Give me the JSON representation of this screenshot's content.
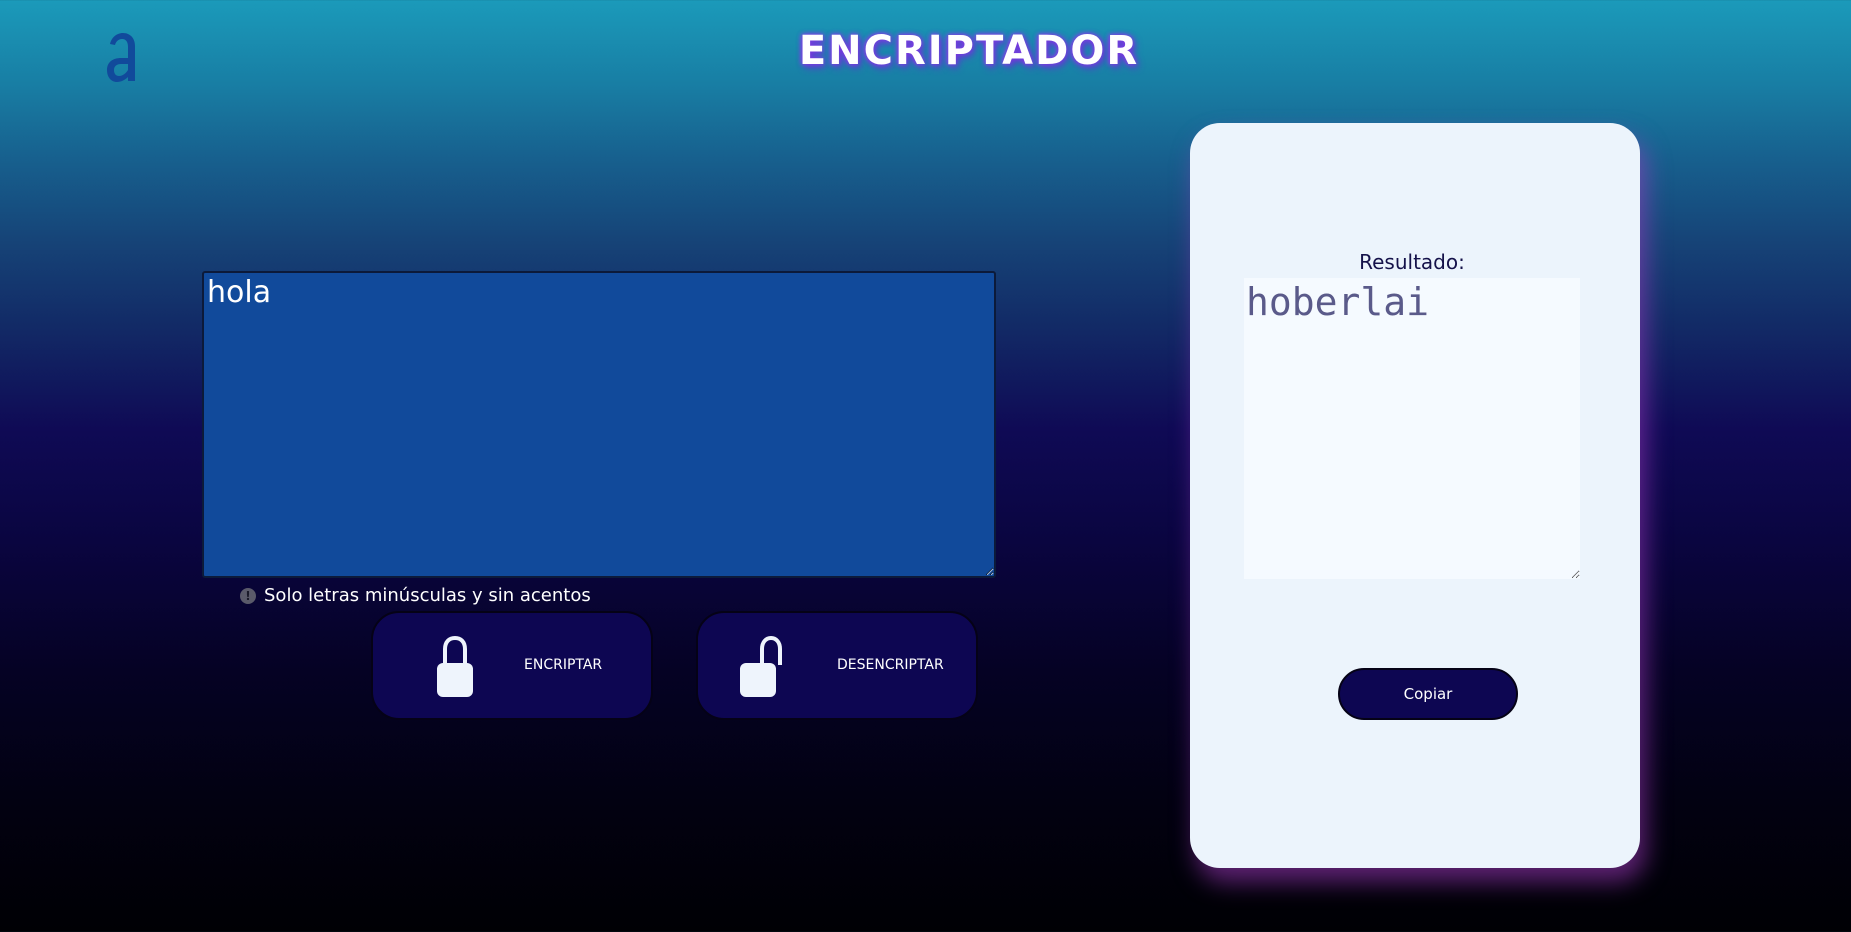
{
  "header": {
    "logo_icon": "alura-a-logo-icon",
    "title": "ENCRIPTADOR"
  },
  "input": {
    "value": "hola",
    "hint": "Solo letras minúsculas y sin acentos",
    "hint_icon": "exclamation-circle-icon"
  },
  "actions": {
    "encrypt_label": "ENCRIPTAR",
    "encrypt_icon": "lock-closed-icon",
    "decrypt_label": "DESENCRIPTAR",
    "decrypt_icon": "lock-open-icon"
  },
  "result": {
    "label": "Resultado:",
    "value": "hoberlai",
    "copy_label": "Copiar"
  },
  "colors": {
    "input_bg": "#114a9b",
    "button_bg": "#0d0652",
    "card_bg": "#ecf4fc",
    "title_glow": "#7b3fe0"
  }
}
